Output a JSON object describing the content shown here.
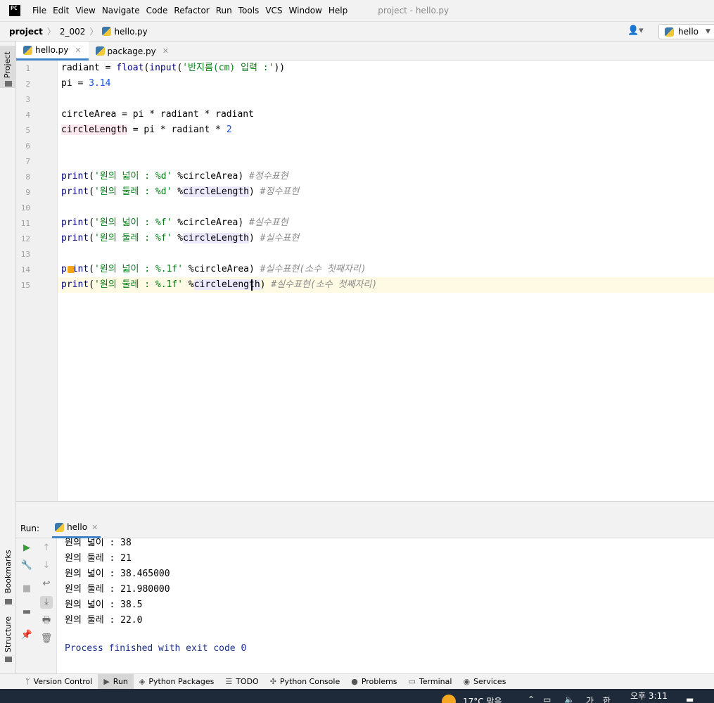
{
  "app": {
    "logo_text": "PC",
    "menu": [
      "File",
      "Edit",
      "View",
      "Navigate",
      "Code",
      "Refactor",
      "Run",
      "Tools",
      "VCS",
      "Window",
      "Help"
    ],
    "window_title": "project - hello.py"
  },
  "nav": {
    "breadcrumbs": [
      "project",
      "2_002",
      "hello.py"
    ],
    "run_config": "hello"
  },
  "left_strip": {
    "project": "Project",
    "bookmarks": "Bookmarks",
    "structure": "Structure"
  },
  "editor": {
    "tabs": [
      {
        "label": "hello.py",
        "active": true
      },
      {
        "label": "package.py",
        "active": false
      }
    ],
    "line_numbers": [
      "1",
      "2",
      "3",
      "4",
      "5",
      "6",
      "7",
      "8",
      "9",
      "10",
      "11",
      "12",
      "13",
      "14",
      "15"
    ],
    "lines": {
      "l1a": "radiant = ",
      "l1b": "float",
      "l1c": "(",
      "l1d": "input",
      "l1e": "(",
      "l1f": "'반지름(cm) 입력 :'",
      "l1g": "))",
      "l2a": "pi = ",
      "l2b": "3.14",
      "l4": "circleArea = pi * radiant * radiant",
      "l5a": "circleLength",
      "l5b": " = pi * radiant * ",
      "l5c": "2",
      "print": "print",
      "l8s": "'원의 넓이 : %d'",
      "l8v": " %circleArea) ",
      "l8c": "#정수표현",
      "l9s": "'원의 둘레 : %d'",
      "l9v1": " %",
      "l9v2": "circleLength",
      "l9v3": ") ",
      "l9c": "#정수표현",
      "l11s": "'원의 넓이 : %f'",
      "l11v": " %circleArea) ",
      "l11c": "#실수표현",
      "l12s": "'원의 둘레 : %f'",
      "l12v1": " %",
      "l12v2": "circleLength",
      "l12v3": ") ",
      "l12c": "#실수표현",
      "l14s": "'원의 넓이 : %.1f'",
      "l14v": " %circleArea) ",
      "l14c": "#실수표현(소수 첫째자리)",
      "l15s": "'원의 둘레 : %.1f'",
      "l15v1": " %",
      "l15v2": "circleLength",
      "l15v3": ") ",
      "l15c": "#실수표현(소수 첫째자리)",
      "paren": "("
    }
  },
  "run": {
    "label": "Run:",
    "tab": "hello",
    "output": [
      "원의 넓이 : 38",
      "원의 둘레 : 21",
      "원의 넓이 : 38.465000",
      "원의 둘레 : 21.980000",
      "원의 넓이 : 38.5",
      "원의 둘레 : 22.0"
    ],
    "exit_message": "Process finished with exit code 0"
  },
  "bottom_bar": [
    "Version Control",
    "Run",
    "Python Packages",
    "TODO",
    "Python Console",
    "Problems",
    "Terminal",
    "Services"
  ],
  "taskbar": {
    "weather": "17°C 맑음",
    "clock": "오후 3:11",
    "ime": "가",
    "lang": "한"
  },
  "colors": {
    "accent": "#4083c9",
    "string": "#067d17",
    "number": "#1750eb",
    "keyword": "#000080",
    "comment": "#8c8c8c"
  }
}
